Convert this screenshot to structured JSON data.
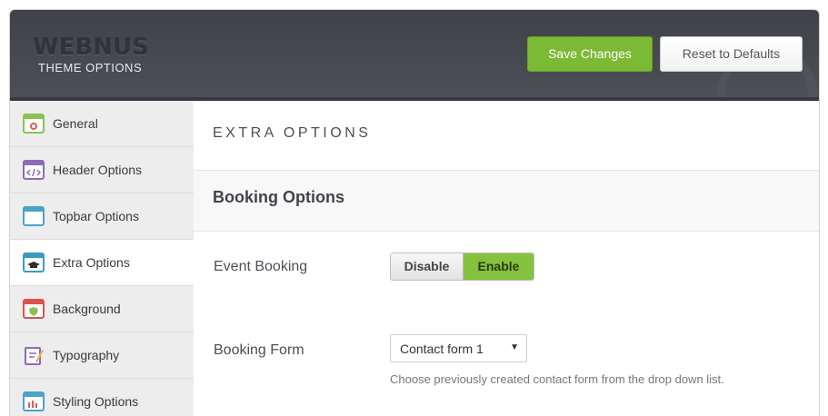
{
  "header": {
    "logo_text": "WEBNUS",
    "logo_subtitle": "THEME OPTIONS",
    "save_label": "Save Changes",
    "reset_label": "Reset to Defaults"
  },
  "sidebar": {
    "items": [
      {
        "label": "General",
        "icon": "gear-window-icon",
        "color": "#8cc152",
        "active": false
      },
      {
        "label": "Header Options",
        "icon": "code-window-icon",
        "color": "#8e6bb8",
        "active": false
      },
      {
        "label": "Topbar Options",
        "icon": "window-icon",
        "color": "#4aa3c8",
        "active": false
      },
      {
        "label": "Extra Options",
        "icon": "graduation-cap-window-icon",
        "color": "#3a9bc2",
        "active": true
      },
      {
        "label": "Background",
        "icon": "shield-window-icon",
        "color": "#d9534f",
        "active": false
      },
      {
        "label": "Typography",
        "icon": "document-pen-icon",
        "color": "#8e6bb8",
        "active": false
      },
      {
        "label": "Styling Options",
        "icon": "bar-chart-window-icon",
        "color": "#4aa3c8",
        "active": false
      }
    ]
  },
  "main": {
    "page_title": "EXTRA OPTIONS",
    "section_title": "Booking Options",
    "event_booking": {
      "label": "Event Booking",
      "disable_label": "Disable",
      "enable_label": "Enable",
      "selected": "Enable"
    },
    "booking_form": {
      "label": "Booking Form",
      "selected": "Contact form 1",
      "help": "Choose previously created contact form from the drop down list."
    }
  },
  "colors": {
    "accent_green": "#7cb935",
    "header_dark": "#44474d"
  }
}
